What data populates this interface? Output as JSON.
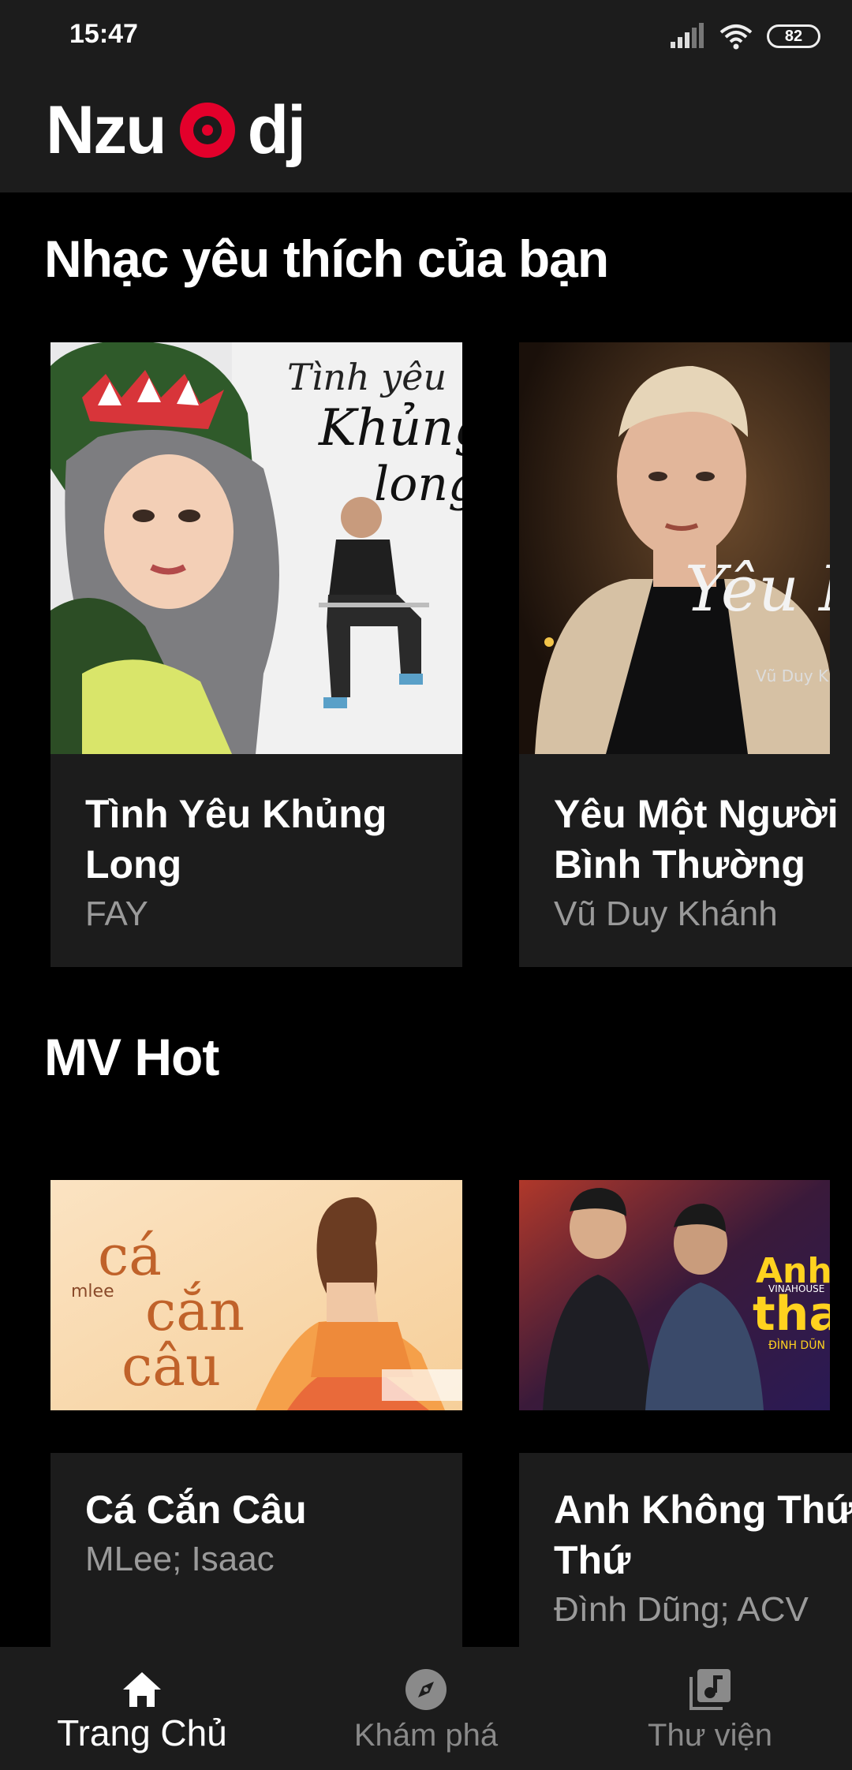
{
  "status_bar": {
    "time": "15:47",
    "battery": "82",
    "icons": [
      "signal-icon",
      "wifi-icon",
      "battery-icon"
    ]
  },
  "app_bar": {
    "logo_left": "Nzu",
    "logo_right": "dj",
    "logo_mark": "record-disc-icon",
    "brand_color": "#e3002b"
  },
  "favorites": {
    "title": "Nhạc yêu thích của bạn",
    "items": [
      {
        "title": "Tình Yêu Khủng\nLong",
        "artist": "FAY",
        "cover_text_1": "Tình yêu",
        "cover_text_2": "Khủng",
        "cover_text_3": "long"
      },
      {
        "title": "Yêu Một Người\nBình Thường",
        "artist": "Vũ Duy Khánh",
        "cover_text_1": "Yêu M",
        "cover_text_2": "Vũ Duy K"
      }
    ]
  },
  "mv_hot": {
    "title": "MV Hot",
    "items": [
      {
        "title": "Cá Cắn Câu",
        "artist": "MLee; Isaac",
        "cover_text_1": "cá",
        "cover_text_2": "cắn",
        "cover_text_3": "câu",
        "cover_text_4": "mlee"
      },
      {
        "title": "Anh Không Thứ\nThứ",
        "artist": "Đình Dũng; ACV",
        "cover_text_1": "Anh K",
        "cover_text_2": "tha",
        "cover_text_3": "VINAHOUSE",
        "cover_text_4": "ĐÌNH DŨN"
      }
    ]
  },
  "bottom_nav": {
    "items": [
      {
        "label": "Trang Chủ",
        "icon": "home-icon",
        "active": true
      },
      {
        "label": "Khám phá",
        "icon": "compass-icon",
        "active": false
      },
      {
        "label": "Thư viện",
        "icon": "music-library-icon",
        "active": false
      }
    ]
  },
  "colors": {
    "background": "#000000",
    "surface": "#1c1c1c",
    "text_primary": "#ffffff",
    "text_secondary": "#9a9a9a",
    "nav_inactive": "#8a8a8a"
  }
}
